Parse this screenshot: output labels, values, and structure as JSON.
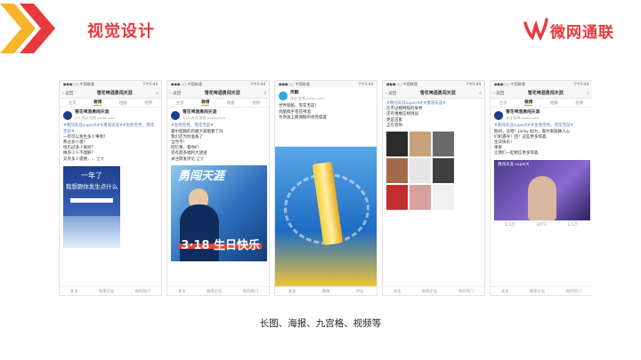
{
  "header": {
    "title": "视觉设计",
    "logo_text": "微网通联",
    "accent_color": "#e8393d",
    "chevron_colors": [
      "#f7b52b",
      "#e8393d"
    ]
  },
  "phones": [
    {
      "status_left": "●●●○○ 中国联通",
      "status_time": "下午5:44",
      "back": "‹ 返回",
      "nav_title": "雪花啤酒勇闯天涯",
      "tabs": [
        "主页",
        "微博",
        "相册",
        "视频"
      ],
      "author": "雪花啤酒勇闯天涯",
      "author_meta": "3-1  来自 微博 weibo.com",
      "hashtag": "#勇闯天涯superX##勇闯天涯##生而无畏，雪花无前#",
      "lines": [
        "一年可以发生多少事情？",
        "熬过多少夜？",
        "经历过多少离别？",
        "做多少人不理解？",
        "又有多少遗憾，..."
      ],
      "more": "全文",
      "image_texts": [
        "一年了",
        "我想跟你发生点什么"
      ],
      "footer": [
        "关注",
        "联系企业",
        "他的热门"
      ]
    },
    {
      "status_left": "●●●○○ 中国联通",
      "status_time": "下午5:44",
      "back": "‹ 返回",
      "nav_title": "雪花啤酒勇闯天涯",
      "tabs": [
        "主页",
        "微博",
        "相册",
        "视频"
      ],
      "author": "雪花啤酒勇闯天涯",
      "author_meta": "3-18  来自 微博 weibo.com",
      "hashtag": "#生而无畏，雪花无前#",
      "lines": [
        "嘉尔超翻的鸡腿大家都看了吗",
        "我们还为你准备了",
        "当然不！",
        "回忆重，看你们",
        "还有超多福利大放送",
        "关注转发评论"
      ],
      "more": "全文",
      "image_texts": [
        "勇闯天涯",
        "3·18 生日快乐"
      ],
      "footer": [
        "关注",
        "联系企业",
        "他的热门"
      ]
    },
    {
      "status_left": "●●●○○ 中国联通",
      "status_time": "下午5:44",
      "back": "",
      "nav_title": "",
      "tabs": [],
      "author": "优酷",
      "author_meta": "来自 微博 weibo.com",
      "hashtag": "",
      "lines": [
        "世界很酷，雪花无前！",
        "优酷携手雪花啤酒",
        "为你送上最潮酷的视觉盛宴"
      ],
      "more": "",
      "image_texts": [],
      "footer": [
        "关注",
        "微博",
        "评论"
      ]
    },
    {
      "status_left": "●●●○○ 中国联通",
      "status_time": "下午5:44",
      "back": "‹ 返回",
      "nav_title": "雪花啤酒勇闯天涯",
      "tabs": [],
      "author": "",
      "author_meta": "",
      "hashtag": "#勇闯天涯superX##勇闯天涯#",
      "lines": [
        "比不过模特般的身材",
        "还有谁敢这样挑战",
        "更是首家",
        "正在等你"
      ],
      "more": "",
      "image_texts": [],
      "footer": [
        "关注",
        "联系企业",
        "他的热门"
      ]
    },
    {
      "status_left": "●●●○○ 中国联通",
      "status_time": "下午5:44",
      "back": "‹ 返回",
      "nav_title": "雪花啤酒勇闯天涯",
      "tabs": [
        "主页",
        "微博",
        "相册",
        "视频"
      ],
      "author": "雪花啤酒勇闯天涯",
      "author_meta": "来自 微博 weibo.com",
      "hashtag": "#勇闯天涯superX##生而无畏，雪花无前#",
      "lines": [
        "期间，没错！Jacky 助力，嘉尔来鼓舞人心",
        "们机遇导！回！这些更多惊喜",
        "生日快乐！",
        "果果",
        "让我们一起相信更多惊喜"
      ],
      "more": "",
      "image_texts": [
        "勇闯天涯 superX"
      ],
      "stats": [
        "5.5万",
        "3473",
        "2.5万"
      ],
      "footer": [
        "关注",
        "联系企业",
        "他的热门"
      ]
    }
  ],
  "caption": "长图、海报、九宫格、视频等"
}
